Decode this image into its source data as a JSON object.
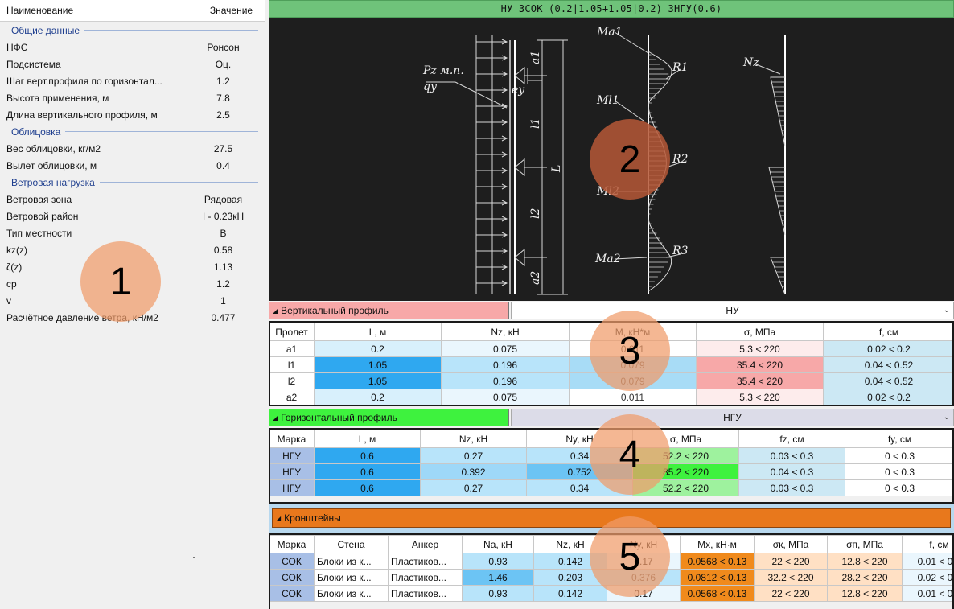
{
  "props": {
    "col_name": "Наименование",
    "col_value": "Значение",
    "groups": [
      {
        "title": "Общие данные",
        "rows": [
          {
            "k": "НФС",
            "v": "Ронсон"
          },
          {
            "k": "Подсистема",
            "v": "Оц."
          },
          {
            "k": "Шаг верт.профиля по горизонтал...",
            "v": "1.2"
          },
          {
            "k": "Высота применения, м",
            "v": "7.8"
          },
          {
            "k": "Длина вертикального профиля, м",
            "v": "2.5"
          }
        ]
      },
      {
        "title": "Облицовка",
        "rows": [
          {
            "k": "Вес облицовки, кг/м2",
            "v": "27.5"
          },
          {
            "k": "Вылет облицовки, м",
            "v": "0.4"
          }
        ]
      },
      {
        "title": "Ветровая нагрузка",
        "rows": [
          {
            "k": "Ветровая зона",
            "v": "Рядовая"
          },
          {
            "k": "Ветровой район",
            "v": "I - 0.23кН"
          },
          {
            "k": "Тип местности",
            "v": "B"
          },
          {
            "k": "kz(z)",
            "v": "0.58"
          },
          {
            "k": "ζ(z)",
            "v": "1.13"
          },
          {
            "k": "cp",
            "v": "1.2"
          },
          {
            "k": "v",
            "v": "1"
          },
          {
            "k": "Расчётное давление ветра, кН/м2",
            "v": "0.477"
          }
        ]
      }
    ]
  },
  "scheme": {
    "title": "НУ_3СОК (0.2|1.05+1.05|0.2) ЗНГУ(0.6)",
    "labels": {
      "pz": "Pz м.п.",
      "qy": "qy",
      "a1": "a1",
      "ey": "ey",
      "l1": "l1",
      "L": "L",
      "l2": "l2",
      "a2": "a2",
      "ma1": "Ma1",
      "ml1": "Ml1",
      "ml2": "Ml2",
      "ma2": "Ma2",
      "r1": "R1",
      "r2": "R2",
      "r3": "R3",
      "nz": "Nz"
    }
  },
  "vert": {
    "title": "Вертикальный профиль",
    "select": "НУ",
    "headers": [
      "Пролет",
      "L, м",
      "Nz, кН",
      "M, кН*м",
      "σ, МПа",
      "f, см"
    ],
    "rows": [
      [
        "a1",
        "0.2",
        "0.075",
        "0.011",
        "5.3 < 220",
        "0.02 < 0.2"
      ],
      [
        "l1",
        "1.05",
        "0.196",
        "0.079",
        "35.4 < 220",
        "0.04 < 0.52"
      ],
      [
        "l2",
        "1.05",
        "0.196",
        "0.079",
        "35.4 < 220",
        "0.04 < 0.52"
      ],
      [
        "a2",
        "0.2",
        "0.075",
        "0.011",
        "5.3 < 220",
        "0.02 < 0.2"
      ]
    ]
  },
  "horiz": {
    "title": "Горизонтальный профиль",
    "select": "НГУ",
    "headers": [
      "Марка",
      "L, м",
      "Nz, кН",
      "Ny, кН",
      "σ, МПа",
      "fz, см",
      "fy, см"
    ],
    "rows": [
      [
        "НГУ",
        "0.6",
        "0.27",
        "0.34",
        "52.2 < 220",
        "0.03 < 0.3",
        "0 < 0.3"
      ],
      [
        "НГУ",
        "0.6",
        "0.392",
        "0.752",
        "85.2 < 220",
        "0.04 < 0.3",
        "0 < 0.3"
      ],
      [
        "НГУ",
        "0.6",
        "0.27",
        "0.34",
        "52.2 < 220",
        "0.03 < 0.3",
        "0 < 0.3"
      ]
    ]
  },
  "bracket": {
    "title": "Кронштейны",
    "headers": [
      "Марка",
      "Стена",
      "Анкер",
      "Na, кН",
      "Nz, кН",
      "Ny, кН",
      "Mx, кН·м",
      "σк, МПа",
      "σп, МПа",
      "f, см"
    ],
    "rows": [
      [
        "СОК",
        "Блоки из к...",
        "Пластиков...",
        "0.93",
        "0.142",
        "0.17",
        "0.0568 < 0.13",
        "22 < 220",
        "12.8 < 220",
        "0.01 < 0.4"
      ],
      [
        "СОК",
        "Блоки из к...",
        "Пластиков...",
        "1.46",
        "0.203",
        "0.376",
        "0.0812 < 0.13",
        "32.2 < 220",
        "28.2 < 220",
        "0.02 < 0.4"
      ],
      [
        "СОК",
        "Блоки из к...",
        "Пластиков...",
        "0.93",
        "0.142",
        "0.17",
        "0.0568 < 0.13",
        "22 < 220",
        "12.8 < 220",
        "0.01 < 0.4"
      ]
    ]
  },
  "badges": [
    "1",
    "2",
    "3",
    "4",
    "5"
  ],
  "colors": {
    "vert_header": "#f7a8a8",
    "horiz_header": "#3ef23e",
    "bracket_header": "#e8781c",
    "scheme_bar": "#6fc37a"
  }
}
